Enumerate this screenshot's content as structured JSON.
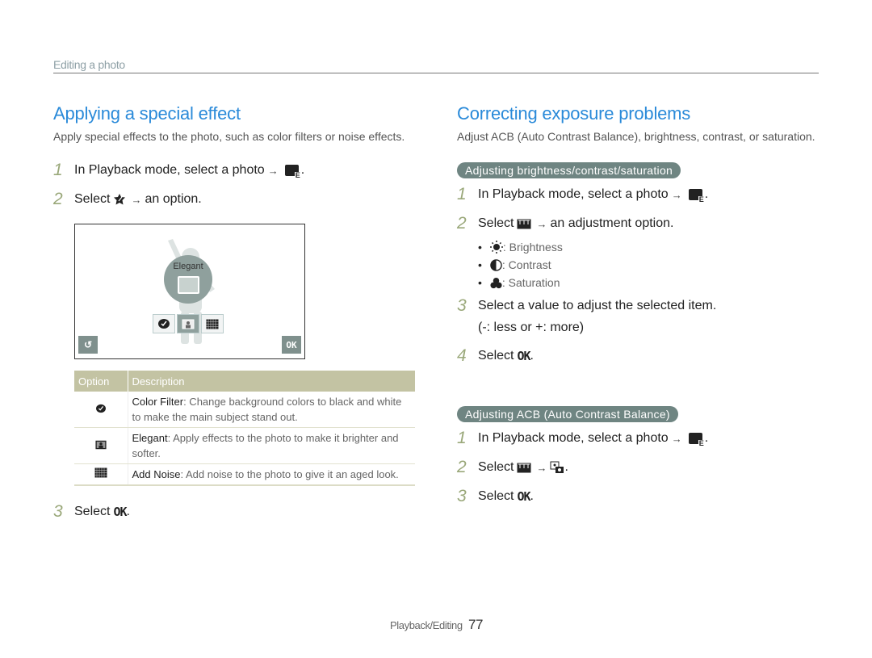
{
  "header": {
    "section": "Editing a photo"
  },
  "left": {
    "title": "Applying a special effect",
    "intro": "Apply special effects to the photo, such as color filters or noise effects.",
    "steps": [
      {
        "num": "1",
        "text": "In Playback mode, select a photo",
        "icon": "edit-icon",
        "suffix": "."
      },
      {
        "num": "2",
        "text": "Select",
        "icon": "special-effect-icon",
        "after": "an option."
      },
      {
        "num": "3",
        "text": "Select",
        "icon": "ok-icon",
        "suffix": "."
      }
    ],
    "ok_glyph": "OK",
    "screen": {
      "bubble_label": "Elegant",
      "back_glyph": "↺",
      "ok_glyph": "OK"
    },
    "table": {
      "headers": [
        "Option",
        "Description"
      ],
      "rows": [
        {
          "icon": "color-filter-icon",
          "name": "Color Filter",
          "desc": ": Change background colors to black and white to make the main subject stand out."
        },
        {
          "icon": "elegant-icon",
          "name": "Elegant",
          "desc": ": Apply effects to the photo to make it brighter and softer."
        },
        {
          "icon": "add-noise-icon",
          "name": "Add Noise",
          "desc": ": Add noise to the photo to give it an aged look."
        }
      ]
    }
  },
  "right": {
    "title": "Correcting exposure problems",
    "intro": "Adjust ACB (Auto Contrast Balance), brightness, contrast, or saturation.",
    "section1": {
      "pill": "Adjusting brightness/contrast/saturation",
      "steps": [
        {
          "num": "1",
          "text": "In Playback mode, select a photo",
          "suffix": "."
        },
        {
          "num": "2",
          "text": "Select",
          "after": "an adjustment option."
        },
        {
          "num": "3",
          "text": "Select a value to adjust the selected item.",
          "sub": "(-: less or +: more)"
        },
        {
          "num": "4",
          "text": "Select",
          "suffix": "."
        }
      ],
      "bullets": [
        {
          "icon": "brightness-icon",
          "label": ": Brightness"
        },
        {
          "icon": "contrast-icon",
          "label": ": Contrast"
        },
        {
          "icon": "saturation-icon",
          "label": ": Saturation"
        }
      ]
    },
    "section2": {
      "pill": "Adjusting ACB (Auto Contrast Balance)",
      "steps": [
        {
          "num": "1",
          "text": "In Playback mode, select a photo",
          "suffix": "."
        },
        {
          "num": "2",
          "text": "Select",
          "suffix": "."
        },
        {
          "num": "3",
          "text": "Select",
          "suffix": "."
        }
      ]
    }
  },
  "arrow": "→",
  "footer": {
    "label": "Playback/Editing",
    "page": "77"
  }
}
